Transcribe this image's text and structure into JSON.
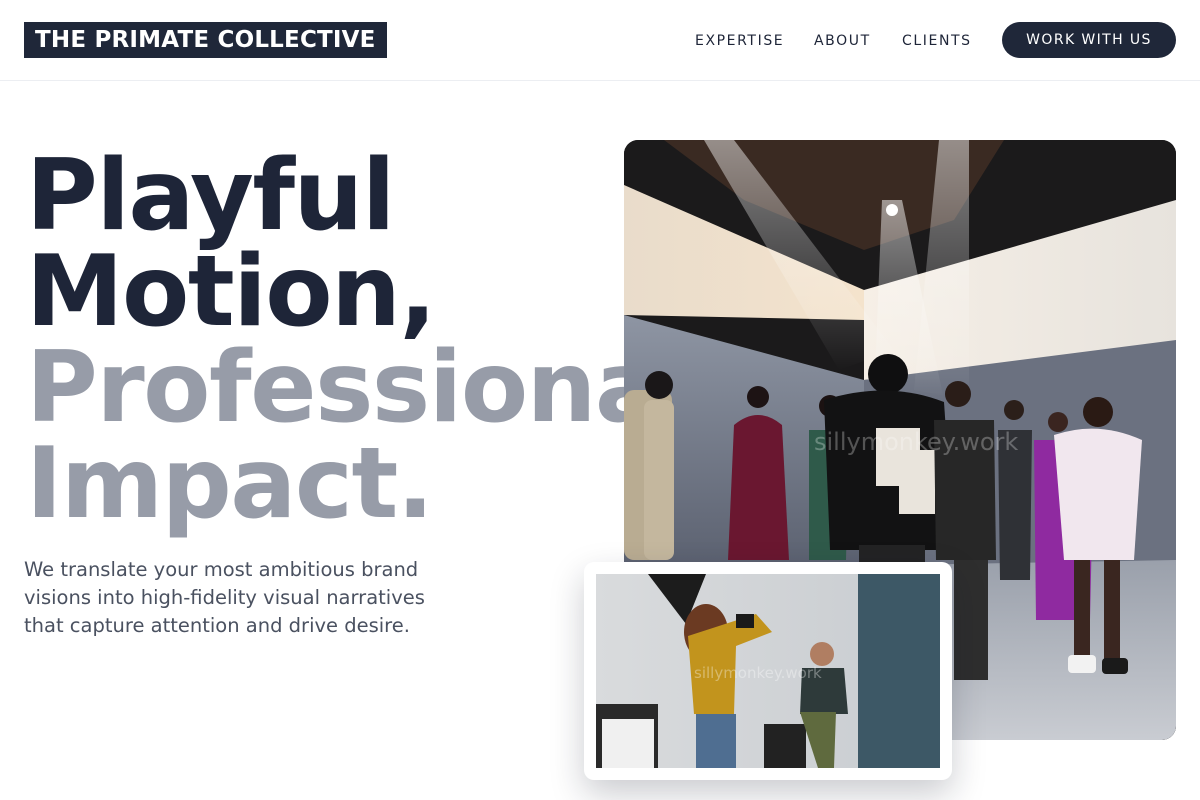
{
  "header": {
    "logo_text": "THE PRIMATE COLLECTIVE",
    "nav": [
      {
        "label": "EXPERTISE"
      },
      {
        "label": "ABOUT"
      },
      {
        "label": "CLIENTS"
      }
    ],
    "cta_label": "WORK WITH US"
  },
  "hero": {
    "headline": {
      "line1": "Playful",
      "line2": "Motion,",
      "line3": "Professional",
      "line4": "Impact."
    },
    "lead": "We translate your most ambitious brand visions into high-fidelity visual narratives that capture attention and drive desire.",
    "main_image_watermark": "sillymonkey.work",
    "inset_image_watermark": "sillymonkey.work"
  },
  "colors": {
    "navy": "#1f2739",
    "muted_headline": "#979ca8",
    "body_text": "#4a5160"
  }
}
